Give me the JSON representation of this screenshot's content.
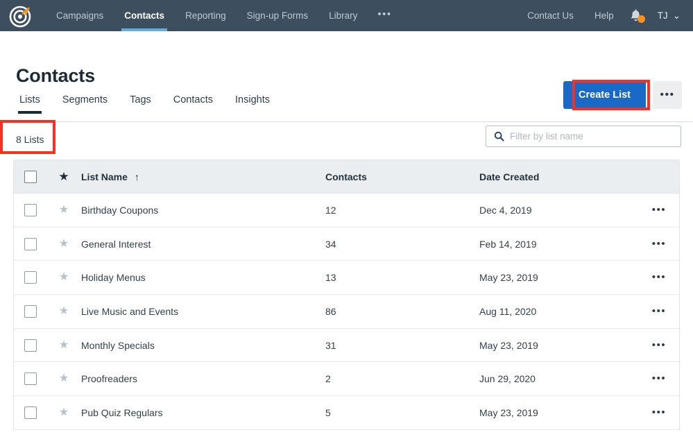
{
  "brand": {
    "logo_icon": "constant-contact-logo-icon",
    "accent": "#f3921f"
  },
  "topnav": {
    "items": [
      {
        "label": "Campaigns",
        "active": false
      },
      {
        "label": "Contacts",
        "active": true
      },
      {
        "label": "Reporting",
        "active": false
      },
      {
        "label": "Sign-up Forms",
        "active": false
      },
      {
        "label": "Library",
        "active": false
      }
    ],
    "overflow": "•••",
    "right": {
      "contact_us": "Contact Us",
      "help": "Help",
      "bell_icon": "notification-bell-icon",
      "user_initials": "TJ",
      "caret": "⌄"
    },
    "bg": "#3d4e5e",
    "active_underline": "#5eaede"
  },
  "header": {
    "title": "Contacts",
    "create_label": "Create List",
    "overflow_label": "•••",
    "primary_color": "#1a68c8"
  },
  "tabs": [
    {
      "label": "Lists",
      "active": true
    },
    {
      "label": "Segments",
      "active": false
    },
    {
      "label": "Tags",
      "active": false
    },
    {
      "label": "Contacts",
      "active": false
    },
    {
      "label": "Insights",
      "active": false
    }
  ],
  "toolbar": {
    "count_label": "8 Lists",
    "search_placeholder": "Filter by list name",
    "search_value": "",
    "search_icon": "search-icon"
  },
  "table": {
    "columns": {
      "star": "★",
      "name": "List Name",
      "sort_arrow": "↑",
      "contacts": "Contacts",
      "date": "Date Created"
    },
    "rows": [
      {
        "name": "Birthday Coupons",
        "contacts": "12",
        "date": "Dec 4, 2019",
        "menu": "•••"
      },
      {
        "name": "General Interest",
        "contacts": "34",
        "date": "Feb 14, 2019",
        "menu": "•••"
      },
      {
        "name": "Holiday Menus",
        "contacts": "13",
        "date": "May 23, 2019",
        "menu": "•••"
      },
      {
        "name": "Live Music and Events",
        "contacts": "86",
        "date": "Aug 11, 2020",
        "menu": "•••"
      },
      {
        "name": "Monthly Specials",
        "contacts": "31",
        "date": "May 23, 2019",
        "menu": "•••"
      },
      {
        "name": "Proofreaders",
        "contacts": "2",
        "date": "Jun 29, 2020",
        "menu": "•••"
      },
      {
        "name": "Pub Quiz Regulars",
        "contacts": "5",
        "date": "May 23, 2019",
        "menu": "•••"
      }
    ]
  },
  "annotations": {
    "color": "#f82f21",
    "boxes": [
      "create-list-button",
      "lists-tab"
    ]
  }
}
